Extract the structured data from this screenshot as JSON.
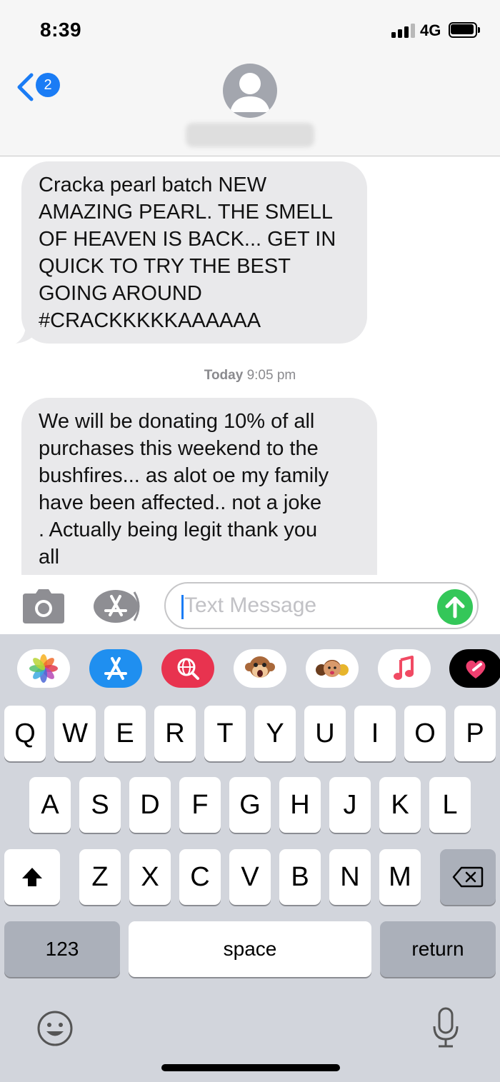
{
  "status_bar": {
    "time": "8:39",
    "network": "4G",
    "signal_bars_active": 3,
    "signal_bars_total": 4
  },
  "header": {
    "unread_count": "2"
  },
  "messages": [
    {
      "direction": "received",
      "text": "Cracka pearl batch NEW\nAMAZING PEARL. THE SMELL\nOF HEAVEN IS BACK... GET IN\nQUICK TO TRY THE BEST\nGOING AROUND\n#CRACKKKKKAAAAAA"
    },
    {
      "direction": "received",
      "text": "We will be donating 10% of all\npurchases this weekend to the\nbushfires... as alot oe my family\nhave been affected.. not a joke\n. Actually being legit thank you\nall"
    }
  ],
  "timestamp": {
    "day": "Today",
    "time": "9:05 pm"
  },
  "compose": {
    "placeholder": "Text Message"
  },
  "app_drawer": [
    "photos-app",
    "app-store-app",
    "web-search-app",
    "animoji-app",
    "memoji-app",
    "music-app",
    "digital-touch-app"
  ],
  "keyboard": {
    "row1": [
      "Q",
      "W",
      "E",
      "R",
      "T",
      "Y",
      "U",
      "I",
      "O",
      "P"
    ],
    "row2": [
      "A",
      "S",
      "D",
      "F",
      "G",
      "H",
      "J",
      "K",
      "L"
    ],
    "row3": [
      "Z",
      "X",
      "C",
      "V",
      "B",
      "N",
      "M"
    ],
    "numbers_label": "123",
    "space_label": "space",
    "return_label": "return"
  },
  "colors": {
    "accent": "#1a7cf5",
    "bubble": "#e9e9eb",
    "send": "#34c759",
    "keyboard_bg": "#d2d5dc"
  }
}
